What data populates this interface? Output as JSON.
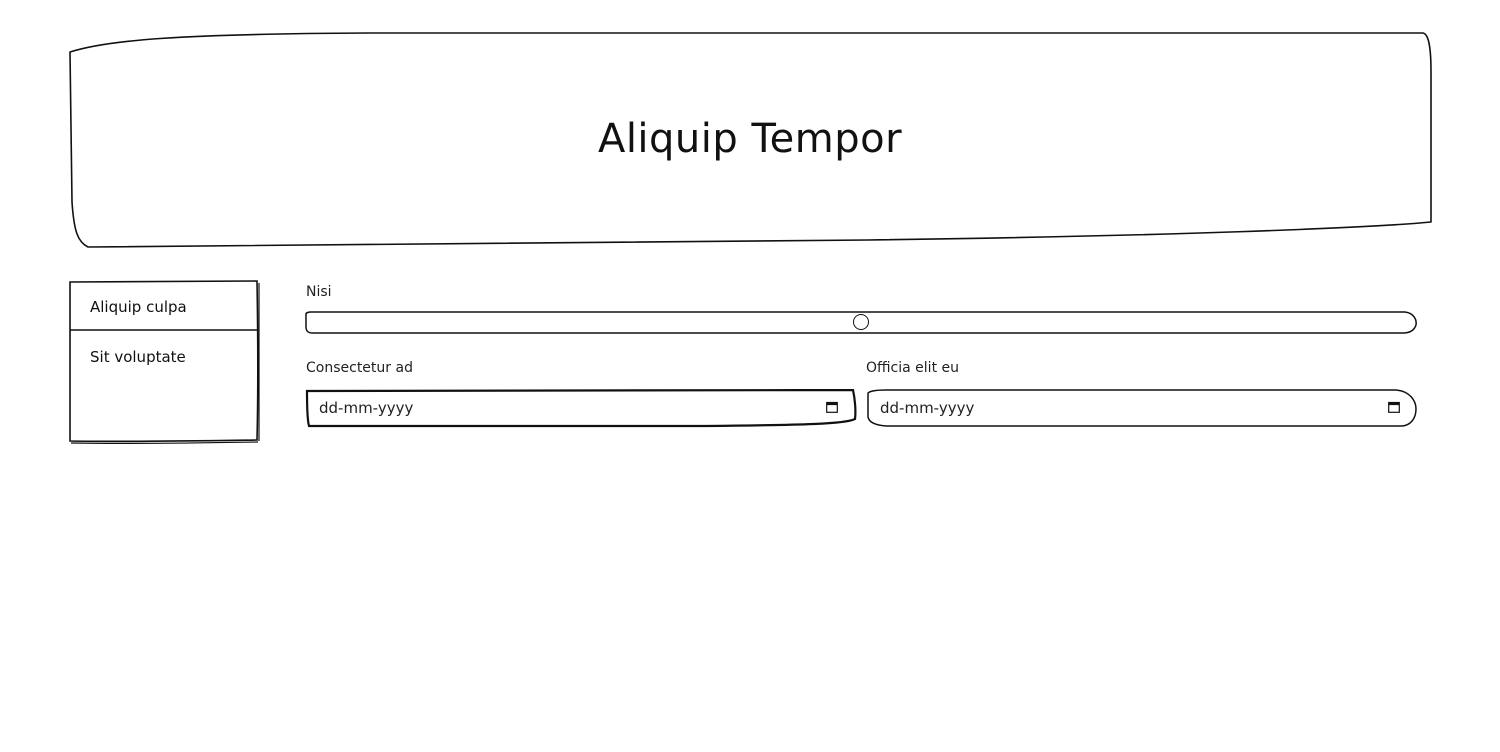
{
  "header": {
    "title": "Aliquip Tempor"
  },
  "sidebar": {
    "items": [
      {
        "label": "Aliquip culpa"
      },
      {
        "label": "Sit voluptate"
      }
    ]
  },
  "form": {
    "slider": {
      "label": "Nisi",
      "value_fraction": 0.5
    },
    "date_fields": [
      {
        "label": "Consectetur ad",
        "placeholder": "dd-mm-yyyy",
        "icon": "calendar-icon"
      },
      {
        "label": "Officia elit eu",
        "placeholder": "dd-mm-yyyy",
        "icon": "calendar-icon"
      }
    ]
  }
}
